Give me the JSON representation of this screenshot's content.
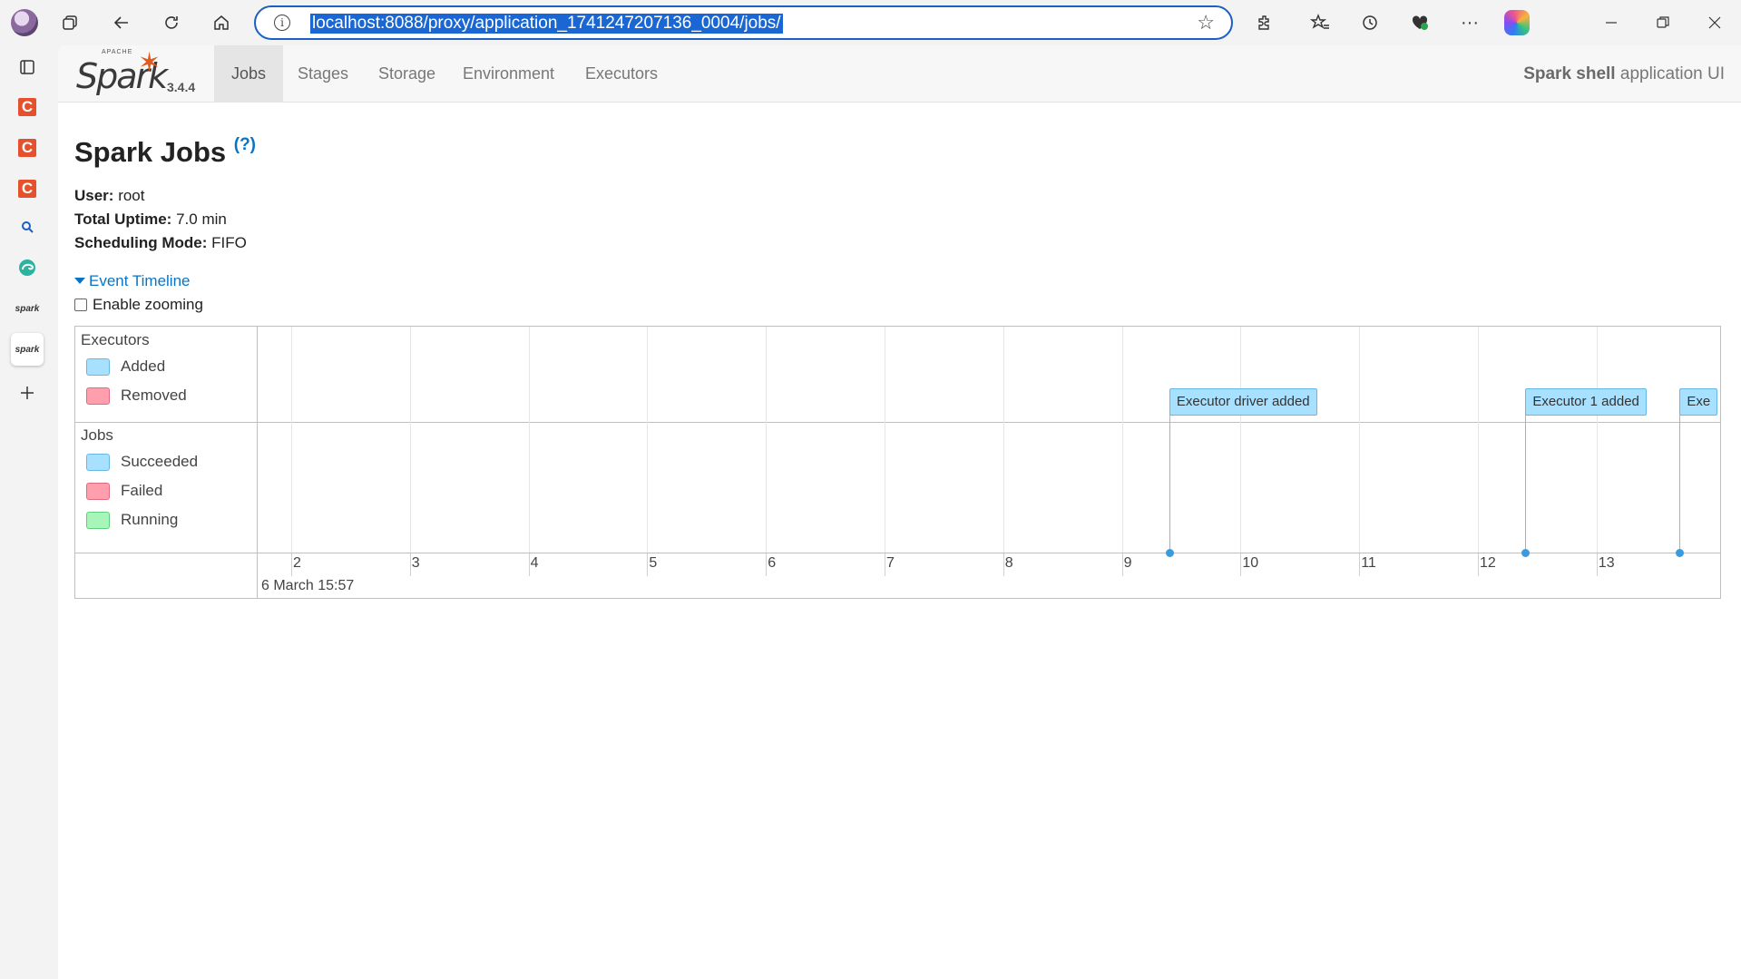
{
  "browser": {
    "url": "localhost:8088/proxy/application_1741247207136_0004/jobs/",
    "icons": [
      "profile-avatar",
      "workspaces-icon",
      "back-icon",
      "refresh-icon",
      "home-icon",
      "info-icon",
      "favorite-star-icon",
      "extensions-icon",
      "favorites-icon",
      "history-icon",
      "browser-essentials-icon",
      "more-icon",
      "copilot-icon",
      "minimize-icon",
      "restore-icon",
      "close-icon"
    ]
  },
  "sidebar": {
    "items": [
      "tab-actions-icon",
      "c-app-icon",
      "c-app-icon",
      "c-app-icon",
      "search-icon",
      "edge-icon",
      "spark-icon",
      "spark-icon",
      "add-icon"
    ],
    "spark_label": "spark"
  },
  "navbar": {
    "logo_text": "Spark",
    "logo_apache": "APACHE",
    "version": "3.4.4",
    "tabs": [
      "Jobs",
      "Stages",
      "Storage",
      "Environment",
      "Executors"
    ],
    "active_tab": "Jobs",
    "app_name": "Spark shell",
    "app_suffix": " application UI"
  },
  "page": {
    "title": "Spark Jobs",
    "help": "(?)",
    "user_label": "User:",
    "user_value": " root",
    "uptime_label": "Total Uptime:",
    "uptime_value": " 7.0 min",
    "mode_label": "Scheduling Mode:",
    "mode_value": " FIFO",
    "event_timeline": "Event Timeline",
    "enable_zooming": "Enable zooming"
  },
  "timeline": {
    "executors_title": "Executors",
    "executor_legend": [
      {
        "label": "Added",
        "fill": "#a8e0ff",
        "border": "#68b8e6"
      },
      {
        "label": "Removed",
        "fill": "#ff9fae",
        "border": "#e06a80"
      }
    ],
    "jobs_title": "Jobs",
    "job_legend": [
      {
        "label": "Succeeded",
        "fill": "#a8e0ff",
        "border": "#68b8e6"
      },
      {
        "label": "Failed",
        "fill": "#ff9fae",
        "border": "#e06a80"
      },
      {
        "label": "Running",
        "fill": "#a7f5b8",
        "border": "#5fcf7c"
      }
    ],
    "ticks": [
      "2",
      "3",
      "4",
      "5",
      "6",
      "7",
      "8",
      "9",
      "10",
      "11",
      "12",
      "13"
    ],
    "date_label": "6 March 15:57",
    "events": [
      {
        "label": "Executor driver added",
        "time": 9.4
      },
      {
        "label": "Executor 1 added",
        "time": 12.4
      },
      {
        "label": "Exe",
        "time": 13.7
      }
    ]
  }
}
